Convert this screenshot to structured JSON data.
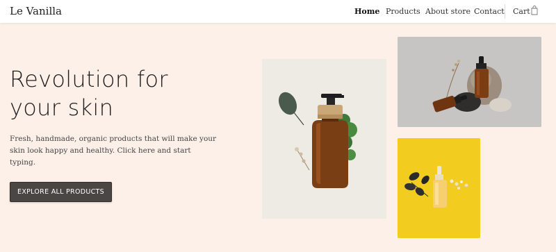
{
  "header": {
    "logo": "Le Vanilla",
    "nav": [
      {
        "label": "Home",
        "active": true
      },
      {
        "label": "Products",
        "active": false
      },
      {
        "label": "About store",
        "active": false
      },
      {
        "label": "Contact",
        "active": false
      }
    ],
    "cart_label": "Cart",
    "cart_icon": "shopping-bag-icon"
  },
  "hero": {
    "title_line1": "Revolution for",
    "title_line2": "your skin",
    "subtitle": "Fresh, handmade, organic products that will make your skin look happy and healthy. Click here and start typing.",
    "cta_label": "EXPLORE ALL PRODUCTS"
  },
  "colors": {
    "background": "#fdf0e8",
    "header_bg": "#ffffff",
    "button_bg": "#4a4643",
    "yellow_tile": "#f2cc1f",
    "grey_tile": "#c6c5c3"
  }
}
